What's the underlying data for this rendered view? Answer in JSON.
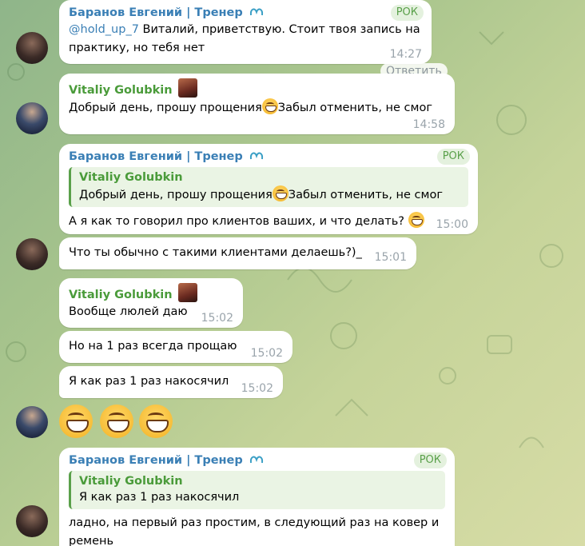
{
  "messages": [
    {
      "sender": "Баранов Евгений | Тренер",
      "role": "РОК",
      "mention": "@hold_up_7",
      "text_line1": " Виталий, приветствую. Стоит твоя запись на",
      "text_line2": "практику, но тебя нет",
      "time": "14:27",
      "reply_label": "Ответить"
    },
    {
      "sender": "Vitaliy Golubkin",
      "text": "Добрый день, прошу прощения",
      "text_after": "Забыл отменить, не смог",
      "time": "14:58"
    },
    {
      "sender": "Баранов Евгений | Тренер",
      "role": "РОК",
      "quote_name": "Vitaliy Golubkin",
      "quote_text": "Добрый день, прошу прощения",
      "quote_text_after": "Забыл отменить, не смог",
      "text": "А я как то говорил про клиентов ваших, и что делать? ",
      "time": "15:00"
    },
    {
      "text": "Что ты обычно с такими клиентами делаешь?)_",
      "time": "15:01"
    },
    {
      "sender": "Vitaliy Golubkin",
      "text": "Вообще люлей даю",
      "time": "15:02"
    },
    {
      "text": "Но на 1 раз всегда прощаю",
      "time": "15:02"
    },
    {
      "text": "Я как раз 1 раз накосячил",
      "time": "15:02"
    },
    {
      "sender": "Баранов Евгений | Тренер",
      "role": "РОК",
      "quote_name": "Vitaliy Golubkin",
      "quote_text": "Я как раз 1 раз накосячил",
      "text_line1": "ладно, на первый раз простим, в следующий раз на ковер и",
      "text_line2": "ремень"
    }
  ],
  "colors": {
    "trainer_name": "#3a7fb5",
    "vitaliy_name": "#4a9b3a",
    "time": "#9aa4ab",
    "bubble": "#ffffff"
  },
  "emoji_reactions": [
    "grinning-face",
    "grinning-face",
    "grinning-face"
  ]
}
